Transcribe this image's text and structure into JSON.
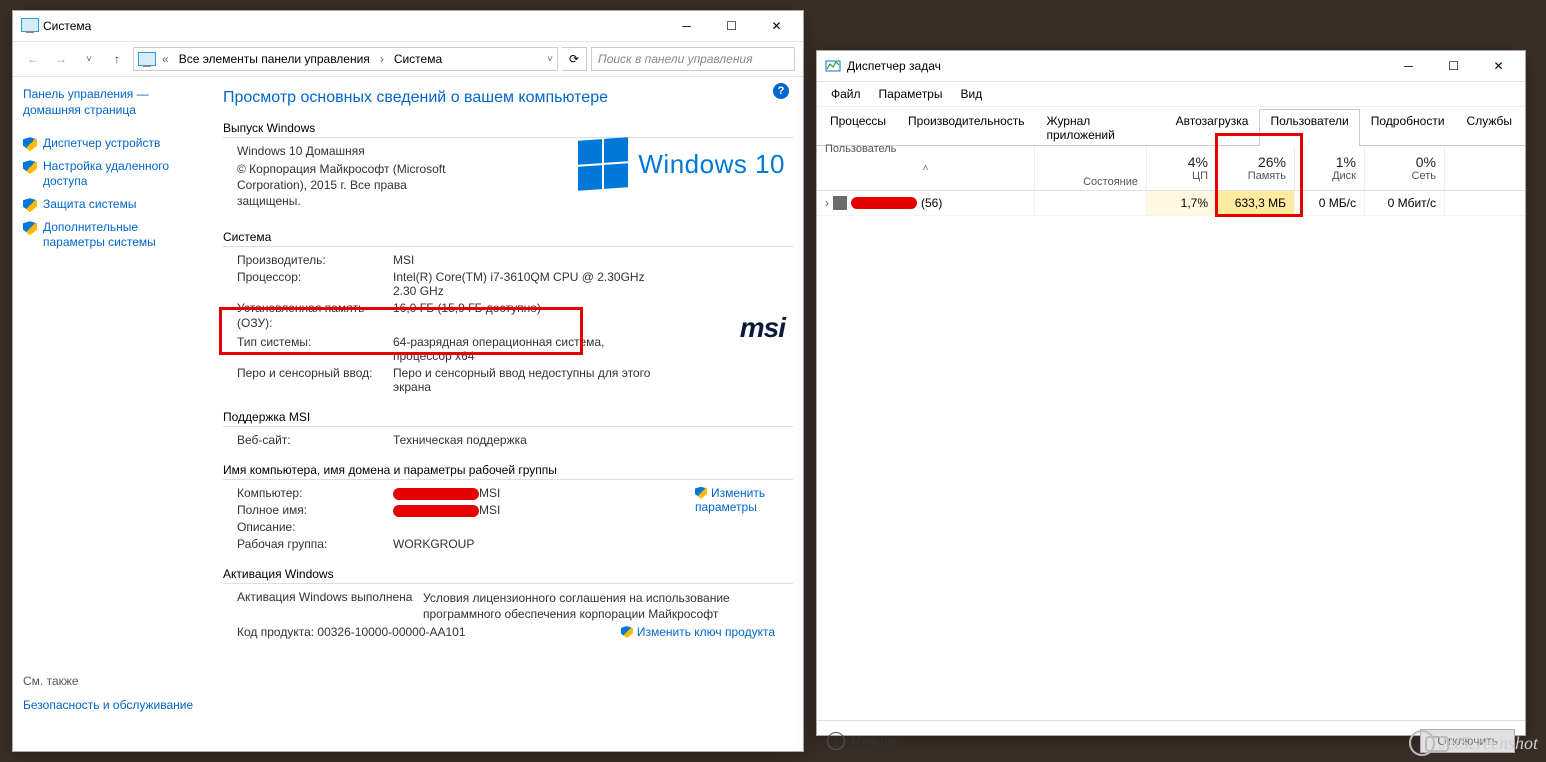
{
  "system_window": {
    "title": "Система",
    "breadcrumb": {
      "root": "Все элементы панели управления",
      "current": "Система"
    },
    "search_placeholder": "Поиск в панели управления",
    "sidebar": {
      "home_label": "Панель управления — домашняя страница",
      "items": [
        "Диспетчер устройств",
        "Настройка удаленного доступа",
        "Защита системы",
        "Дополнительные параметры системы"
      ],
      "see_also_hdr": "См. также",
      "see_also": "Безопасность и обслуживание"
    },
    "heading": "Просмотр основных сведений о вашем компьютере",
    "sections": {
      "edition_hdr": "Выпуск Windows",
      "edition_name": "Windows 10 Домашняя",
      "edition_copy": "© Корпорация Майкрософт (Microsoft Corporation), 2015 г. Все права защищены.",
      "windows10_text": "Windows 10",
      "system_hdr": "Система",
      "system": {
        "mfr_k": "Производитель:",
        "mfr_v": "MSI",
        "cpu_k": "Процессор:",
        "cpu_v": "Intel(R) Core(TM) i7-3610QM CPU @ 2.30GHz 2.30 GHz",
        "ram_k": "Установленная память (ОЗУ):",
        "ram_v": "16,0 ГБ (15,9 ГБ доступно)",
        "type_k": "Тип системы:",
        "type_v": "64-разрядная операционная система, процессор x64",
        "pen_k": "Перо и сенсорный ввод:",
        "pen_v": "Перо и сенсорный ввод недоступны для этого экрана"
      },
      "support_hdr": "Поддержка MSI",
      "support_site_k": "Веб-сайт:",
      "support_site_v": "Техническая поддержка",
      "msi_logo": "msi",
      "name_hdr": "Имя компьютера, имя домена и параметры рабочей группы",
      "name": {
        "pc_k": "Компьютер:",
        "pc_v_suffix": "MSI",
        "full_k": "Полное имя:",
        "full_v_suffix": "MSI",
        "desc_k": "Описание:",
        "wg_k": "Рабочая группа:",
        "wg_v": "WORKGROUP",
        "change_link": "Изменить параметры"
      },
      "activation_hdr": "Активация Windows",
      "activation": {
        "status_k": "Активация Windows выполнена",
        "terms_link": "Условия лицензионного соглашения на использование программного обеспечения корпорации Майкрософт",
        "key_k": "Код продукта: 00326-10000-00000-AA101",
        "key_link": "Изменить ключ продукта"
      }
    }
  },
  "task_manager": {
    "title": "Диспетчер задач",
    "menu": [
      "Файл",
      "Параметры",
      "Вид"
    ],
    "tabs": [
      "Процессы",
      "Производительность",
      "Журнал приложений",
      "Автозагрузка",
      "Пользователи",
      "Подробности",
      "Службы"
    ],
    "active_tab": "Пользователи",
    "columns": {
      "user": "Пользователь",
      "state": "Состояние",
      "cpu": "ЦП",
      "cpu_pct": "4%",
      "mem": "Память",
      "mem_pct": "26%",
      "disk": "Диск",
      "disk_pct": "1%",
      "net": "Сеть",
      "net_pct": "0%"
    },
    "row": {
      "user_suffix": "(56)",
      "cpu": "1,7%",
      "mem": "633,3 МБ",
      "disk": "0 МБ/с",
      "net": "0 Мбит/с"
    },
    "fewer": "Меньше",
    "disconnect_btn": "Отключить"
  },
  "watermark": "JetScreenshot"
}
